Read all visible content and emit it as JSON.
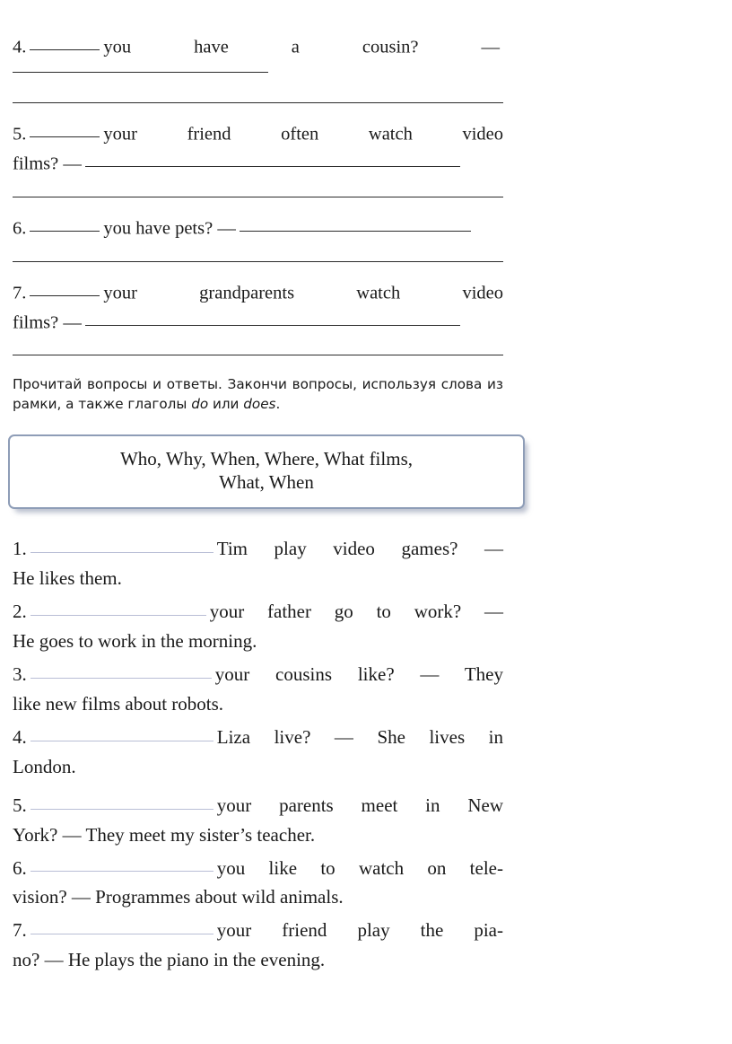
{
  "exercise_top": {
    "items": [
      {
        "number": "4.",
        "text_after_blank": "you have a cousin?  —",
        "answer_rules": 1
      },
      {
        "number": "5.",
        "text_after_blank": "your friend often watch video",
        "continuation": "films?  —",
        "answer_rules": 1
      },
      {
        "number": "6.",
        "text_after_blank": "you have pets?  —",
        "answer_rules": 1
      },
      {
        "number": "7.",
        "text_after_blank": "your grandparents watch video",
        "continuation": "films?  —",
        "answer_rules": 1
      }
    ]
  },
  "instruction": {
    "part1": "Прочитай вопросы и ответы. Закончи вопросы, используя слова из рамки, а также глаголы ",
    "italic1": "do",
    "part2": " или ",
    "italic2": "does",
    "part3": "."
  },
  "word_box": {
    "line1": "Who,  Why,  When,  Where,  What films,",
    "line2": "What,  When",
    "border_color": "#8e9db7",
    "words": [
      "Who",
      "Why",
      "When",
      "Where",
      "What films",
      "What",
      "When"
    ]
  },
  "exercise_bottom": {
    "blank_color": "#b9bed6",
    "items": [
      {
        "number": "1.",
        "question_tail": "Tim play video games?  —",
        "answer": "He likes them."
      },
      {
        "number": "2.",
        "question_tail": "your father go to work?  —",
        "answer": "He goes to work in the morning."
      },
      {
        "number": "3.",
        "question_tail": "your cousins like?  —  They",
        "answer": "like new films about robots."
      },
      {
        "number": "4.",
        "question_tail": "Liza live?  —  She lives in",
        "answer": "London."
      },
      {
        "number": "5.",
        "question_tail": "your parents meet in New",
        "answer": "York?  —  They meet my sister’s teacher."
      },
      {
        "number": "6.",
        "question_tail": "you like to watch on tele-",
        "answer": "vision?  —  Programmes about wild animals."
      },
      {
        "number": "7.",
        "question_tail": "your friend play the pia-",
        "answer": "no?  —  He plays the piano in the evening."
      }
    ]
  }
}
